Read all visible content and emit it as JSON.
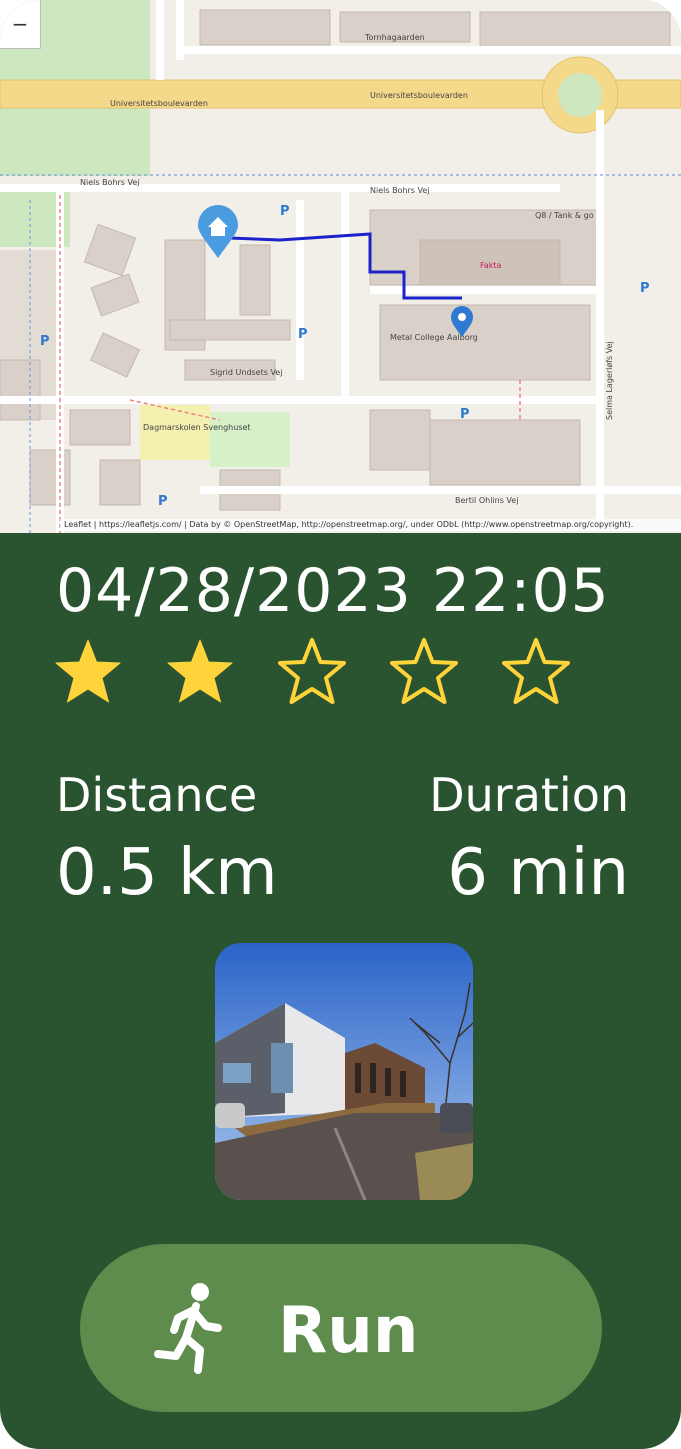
{
  "map": {
    "attribution": "Leaflet | https://leafletjs.com/ | Data by © OpenStreetMap, http://openstreetmap.org/, under ODbL (http://www.openstreetmap.org/copyright).",
    "zoom_out_label": "−",
    "streets": {
      "top": "Universitetsboulevarden",
      "second": "Niels Bohrs Vej",
      "tornhagaarden": "Tornhagaarden",
      "signid": "Sigrid Undsets Vej",
      "selma": "Selma Lagerløfs Vej",
      "bertil": "Bertil Ohlins Vej",
      "tank": "Q8 / Tank & go",
      "fakta": "Fakta",
      "metal": "Metal College Aalborg",
      "bornehave": "Dagmarskolen Svenghuset"
    },
    "icons": {
      "start": "home-marker-icon",
      "end": "location-pin-icon"
    }
  },
  "run": {
    "datetime": "04/28/2023 22:05",
    "rating": 2,
    "rating_max": 5,
    "distance_label": "Distance",
    "distance_value": "0.5 km",
    "duration_label": "Duration",
    "duration_value": "6 min"
  },
  "action": {
    "label": "Run",
    "icon": "running-person-icon"
  },
  "colors": {
    "background": "#2a5430",
    "button": "#5e8c4d",
    "star_fill": "#ffd43b",
    "route": "#1a22cc"
  }
}
